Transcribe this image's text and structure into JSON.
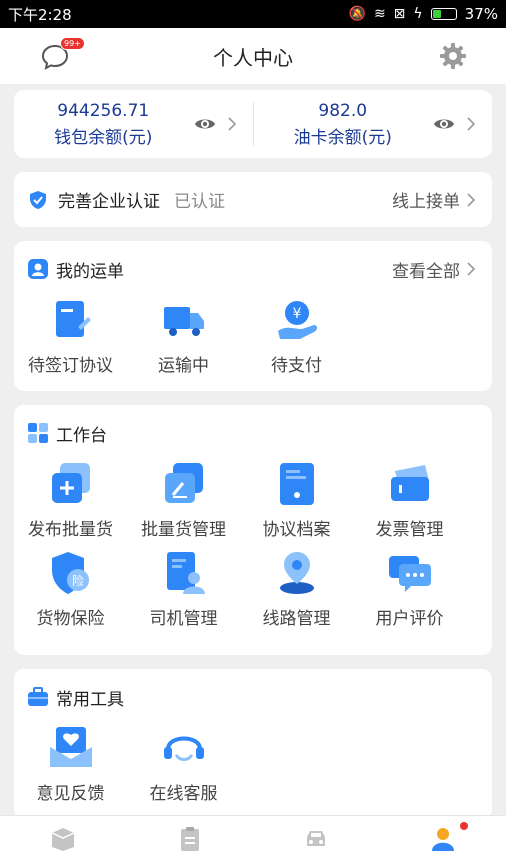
{
  "status_bar": {
    "time": "下午2:28",
    "battery": "37%",
    "battery_level": 0.37,
    "battery_color": "#3ed13e"
  },
  "header": {
    "title": "个人中心",
    "message_badge": "99+"
  },
  "wallet": {
    "amount": "944256.71",
    "label": "钱包余额(元)",
    "fuel_amount": "982.0",
    "fuel_label": "油卡余额(元)",
    "text_color": "#1b3a96"
  },
  "auth": {
    "title": "完善企业认证",
    "status": "已认证",
    "action": "线上接单"
  },
  "orders": {
    "title": "我的运单",
    "more": "查看全部",
    "items": [
      {
        "label": "待签订协议",
        "icon": "document-icon"
      },
      {
        "label": "运输中",
        "icon": "truck-icon"
      },
      {
        "label": "待支付",
        "icon": "yen-hand-icon"
      }
    ]
  },
  "workbench": {
    "title": "工作台",
    "items": [
      {
        "label": "发布批量货",
        "icon": "add-cargo-icon"
      },
      {
        "label": "批量货管理",
        "icon": "cargo-manage-icon"
      },
      {
        "label": "协议档案",
        "icon": "agreement-icon"
      },
      {
        "label": "发票管理",
        "icon": "invoice-icon"
      },
      {
        "label": "货物保险",
        "icon": "insurance-icon",
        "icon_text": "险"
      },
      {
        "label": "司机管理",
        "icon": "driver-icon"
      },
      {
        "label": "线路管理",
        "icon": "route-icon"
      },
      {
        "label": "用户评价",
        "icon": "review-icon"
      }
    ]
  },
  "tools": {
    "title": "常用工具",
    "items": [
      {
        "label": "意见反馈",
        "icon": "feedback-icon"
      },
      {
        "label": "在线客服",
        "icon": "customer-service-icon"
      }
    ]
  },
  "tabbar": {
    "items": [
      {
        "icon": "cargo-box-icon"
      },
      {
        "icon": "orders-list-icon"
      },
      {
        "icon": "car-icon"
      },
      {
        "icon": "profile-icon",
        "active": true
      }
    ],
    "accent": "#2f86f6"
  }
}
